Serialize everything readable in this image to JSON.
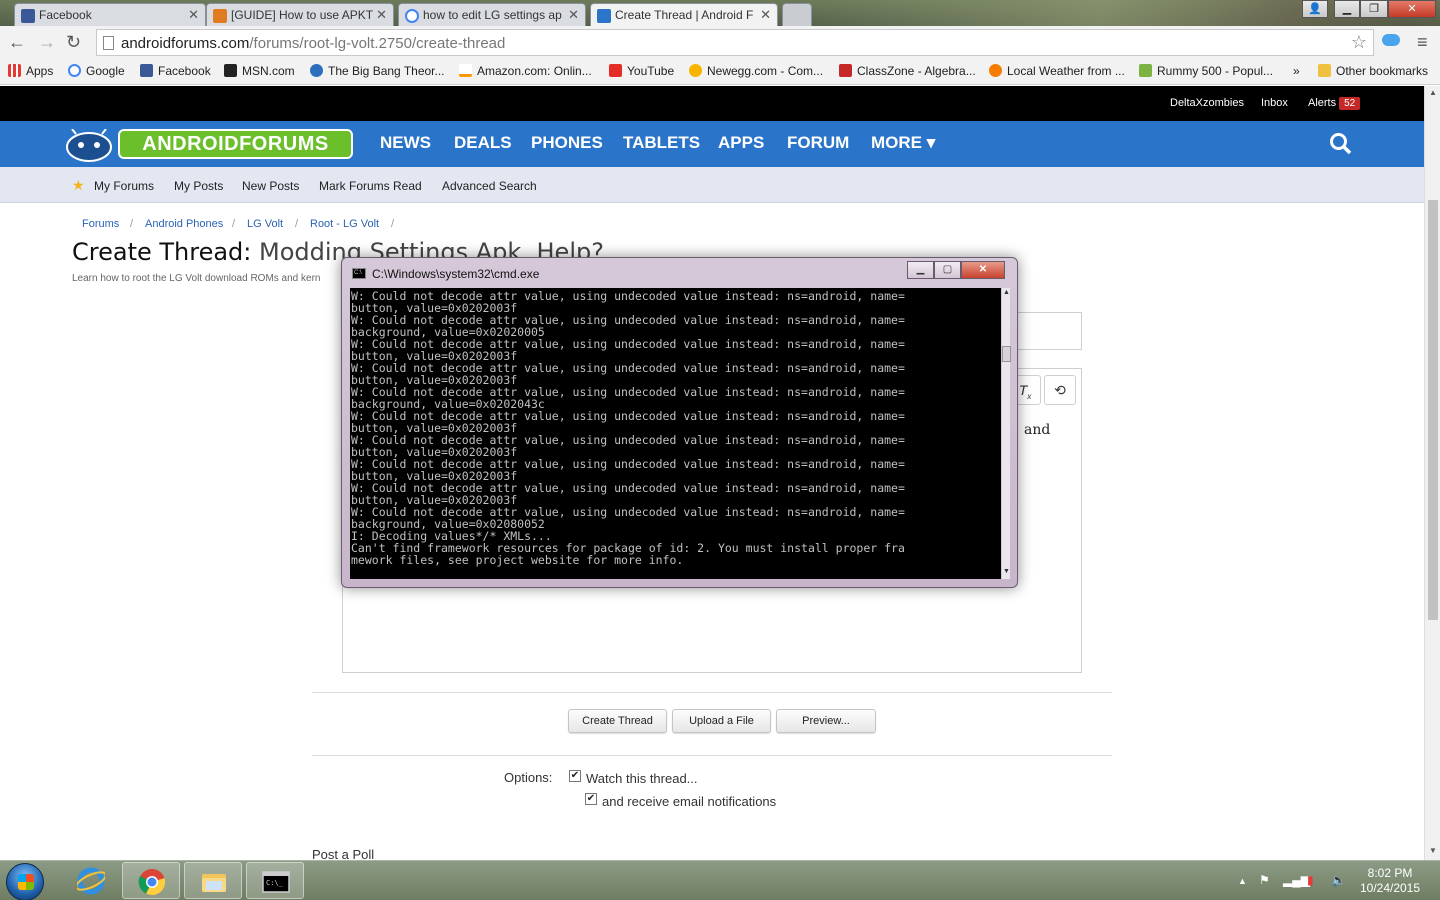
{
  "browser": {
    "tabs": [
      {
        "title": "Facebook",
        "favicon_color": "#3b5998"
      },
      {
        "title": "[GUIDE] How to use APKT",
        "favicon_color": "#e07b21"
      },
      {
        "title": "how to edit LG settings ap",
        "favicon_color": "#4285f4"
      },
      {
        "title": "Create Thread | Android F",
        "favicon_color": "#2a74c9"
      }
    ],
    "url_host": "androidforums.com",
    "url_path": "/forums/root-lg-volt.2750/create-thread",
    "bookmarks": [
      {
        "label": "Apps",
        "icon_color": "#e53935"
      },
      {
        "label": "Google",
        "icon_color": "#4285f4"
      },
      {
        "label": "Facebook",
        "icon_color": "#3b5998"
      },
      {
        "label": "MSN.com",
        "icon_color": "#222222"
      },
      {
        "label": "The Big Bang Theor...",
        "icon_color": "#2c6fbf"
      },
      {
        "label": "Amazon.com: Onlin...",
        "icon_color": "#ff9900"
      },
      {
        "label": "YouTube",
        "icon_color": "#e52d27"
      },
      {
        "label": "Newegg.com - Com...",
        "icon_color": "#f7b500"
      },
      {
        "label": "ClassZone - Algebra...",
        "icon_color": "#c62828"
      },
      {
        "label": "Local Weather from ...",
        "icon_color": "#f57c00"
      },
      {
        "label": "Rummy 500 - Popul...",
        "icon_color": "#7cb342"
      }
    ],
    "bookmarks_overflow": "»",
    "other_bookmarks": "Other bookmarks"
  },
  "forum": {
    "user_links": {
      "username": "DeltaXzombies",
      "inbox": "Inbox",
      "alerts": "Alerts",
      "alerts_count": "52"
    },
    "logo_text": "ANDROIDFORUMS",
    "main_nav": [
      "NEWS",
      "DEALS",
      "PHONES",
      "TABLETS",
      "APPS",
      "FORUM",
      "MORE ▾"
    ],
    "sub_nav": [
      "My Forums",
      "My Posts",
      "New Posts",
      "Mark Forums Read",
      "Advanced Search"
    ],
    "breadcrumb": [
      "Forums",
      "Android Phones",
      "LG Volt",
      "Root - LG Volt"
    ],
    "page_title_prefix": "Create Thread:",
    "page_title_thread": "Modding Settings Apk, Help?",
    "page_description": "Learn how to root the LG Volt download ROMs and kern",
    "editor_visible_text": "and",
    "buttons": {
      "create_thread": "Create Thread",
      "upload_file": "Upload a File",
      "preview": "Preview..."
    },
    "options_label": "Options:",
    "option_watch": "Watch this thread...",
    "option_email": "and receive email notifications",
    "post_poll": "Post a Poll"
  },
  "cmd_window": {
    "title": "C:\\Windows\\system32\\cmd.exe",
    "lines": [
      "W: Could not decode attr value, using undecoded value instead: ns=android, name=",
      "button, value=0x0202003f",
      "W: Could not decode attr value, using undecoded value instead: ns=android, name=",
      "background, value=0x02020005",
      "W: Could not decode attr value, using undecoded value instead: ns=android, name=",
      "button, value=0x0202003f",
      "W: Could not decode attr value, using undecoded value instead: ns=android, name=",
      "button, value=0x0202003f",
      "W: Could not decode attr value, using undecoded value instead: ns=android, name=",
      "background, value=0x0202043c",
      "W: Could not decode attr value, using undecoded value instead: ns=android, name=",
      "button, value=0x0202003f",
      "W: Could not decode attr value, using undecoded value instead: ns=android, name=",
      "button, value=0x0202003f",
      "W: Could not decode attr value, using undecoded value instead: ns=android, name=",
      "button, value=0x0202003f",
      "W: Could not decode attr value, using undecoded value instead: ns=android, name=",
      "button, value=0x0202003f",
      "W: Could not decode attr value, using undecoded value instead: ns=android, name=",
      "background, value=0x02080052",
      "I: Decoding values*/* XMLs...",
      "Can't find framework resources for package of id: 2. You must install proper fra",
      "mework files, see project website for more info."
    ]
  },
  "taskbar": {
    "clock_time": "8:02 PM",
    "clock_date": "10/24/2015",
    "apps": [
      "internet-explorer",
      "chrome",
      "file-explorer",
      "cmd"
    ]
  },
  "colors": {
    "forum_blue": "#2a74c9",
    "logo_green": "#6bbf2b",
    "alert_red": "#c62828"
  }
}
